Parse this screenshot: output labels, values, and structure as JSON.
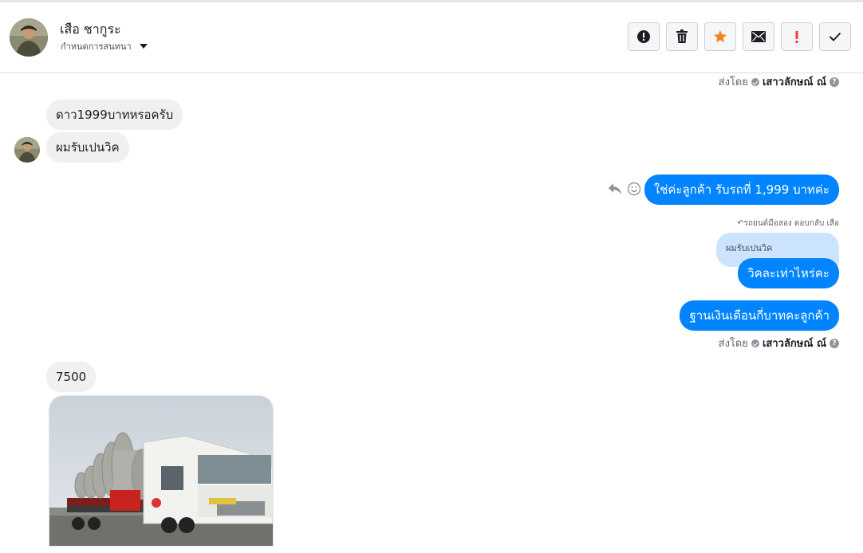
{
  "header": {
    "contact_name": "เสือ ชากูระ",
    "assign_label": "กำหนดการสนทนา"
  },
  "toolbar": {
    "buttons": [
      "alert-icon",
      "trash-icon",
      "star-icon",
      "mail-icon",
      "exclamation-icon",
      "check-icon"
    ],
    "accent_colors": {
      "star": "#f5821f",
      "exclamation": "#fa383e"
    }
  },
  "thread": {
    "sent_by_label": "ส่งโดย",
    "sender_name": "เสาวลักษณ์ ณ์",
    "incoming": {
      "msg1": "ดาว1999บาทหรอครับ",
      "msg2": "ผมรับเปนวิค",
      "msg3": "7500"
    },
    "outgoing": {
      "msg1": "ใช่ค่ะลูกค้า รับรถที่ 1,999 บาทค่ะ",
      "reply_meta": "รถยนต์มือสอง ตอบกลับ เสือ",
      "quoted_text": "ผมรับเปนวิค",
      "msg2": "วิคละเท่าไหร่คะ",
      "msg3": "ฐานเงินเดือนกี่บาทคะลูกค้า"
    }
  },
  "colors": {
    "outgoing_bubble": "#0084ff",
    "incoming_bubble": "#f1f0f0",
    "quoted_bubble": "#cce4ff"
  }
}
